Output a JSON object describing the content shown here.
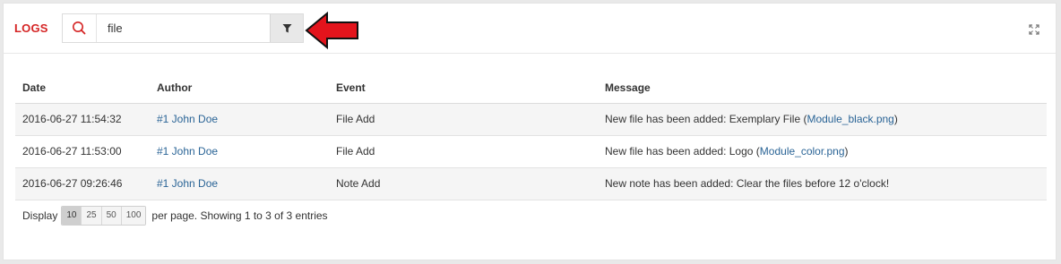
{
  "panel": {
    "title": "LOGS",
    "search": {
      "value": "file"
    }
  },
  "table": {
    "columns": [
      "Date",
      "Author",
      "Event",
      "Message"
    ],
    "rows": [
      {
        "date": "2016-06-27 11:54:32",
        "author": "#1 John Doe",
        "event": "File Add",
        "message_prefix": "New file has been added: Exemplary File (",
        "message_link": "Module_black.png",
        "message_suffix": ")"
      },
      {
        "date": "2016-06-27 11:53:00",
        "author": "#1 John Doe",
        "event": "File Add",
        "message_prefix": "New file has been added: Logo (",
        "message_link": "Module_color.png",
        "message_suffix": ")"
      },
      {
        "date": "2016-06-27 09:26:46",
        "author": "#1 John Doe",
        "event": "Note Add",
        "message_prefix": "New note has been added: Clear the files before 12 o'clock!",
        "message_link": "",
        "message_suffix": ""
      }
    ]
  },
  "footer": {
    "display_label": "Display",
    "page_sizes": [
      "10",
      "25",
      "50",
      "100"
    ],
    "selected_page_size": "10",
    "summary": "per page. Showing 1 to 3 of 3 entries"
  },
  "colors": {
    "title": "#d52525",
    "link": "#2a6496",
    "arrow": "#e3141c"
  }
}
